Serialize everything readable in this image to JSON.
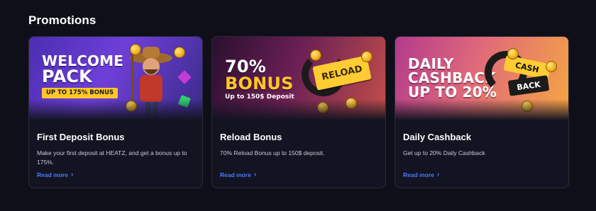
{
  "section": {
    "title": "Promotions"
  },
  "cards": [
    {
      "banner_line1": "WELCOME",
      "banner_line2": "PACK",
      "banner_pill": "UP TO 175% BONUS",
      "title": "First Deposit Bonus",
      "description": "Make your first deposit at HEATZ, and get a bonus up to 175%.",
      "link": "Read more"
    },
    {
      "banner_line1": "70%",
      "banner_line2": "BONUS",
      "banner_sub": "Up to 150$ Deposit",
      "badge": "RELOAD",
      "title": "Reload Bonus",
      "description": "70% Reload Bonus up to 150$ deposit.",
      "link": "Read more"
    },
    {
      "banner_line1": "DAILY",
      "banner_line2": "CASHBACK",
      "banner_line3": "UP TO 20%",
      "tag_top": "CASH",
      "tag_bottom": "BACK",
      "title": "Daily Cashback",
      "description": "Get up to 20% Daily Cashback",
      "link": "Read more"
    }
  ],
  "colors": {
    "background": "#0f0f1a",
    "card": "#131421",
    "accent_link": "#4b7bff",
    "gold": "#ffc727"
  }
}
